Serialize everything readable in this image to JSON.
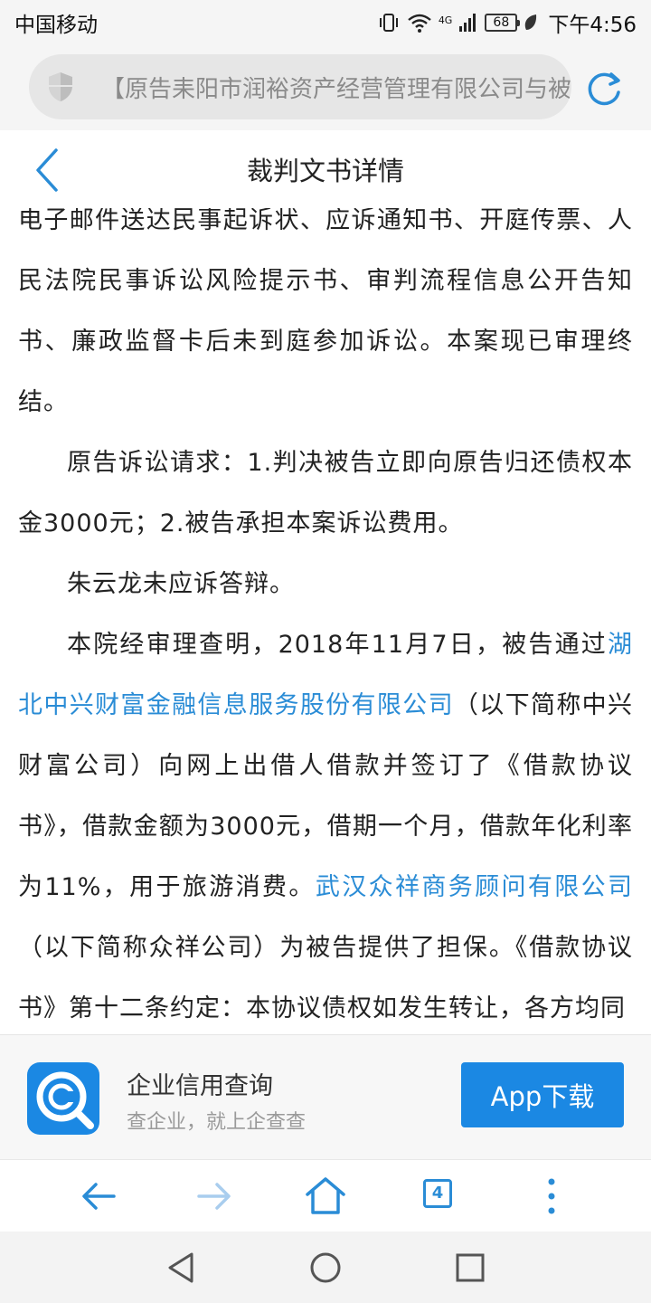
{
  "status_bar": {
    "carrier": "中国移动",
    "network": "4G",
    "battery": "68",
    "time": "下午4:56"
  },
  "url_bar": {
    "url_text": "【原告耒阳市润裕资产经营管理有限公司与被"
  },
  "header": {
    "title": "裁判文书详情"
  },
  "article": {
    "p1": "电子邮件送达民事起诉状、应诉通知书、开庭传票、人民法院民事诉讼风险提示书、审判流程信息公开告知书、廉政监督卡后未到庭参加诉讼。本案现已审理终结。",
    "p2": "原告诉讼请求：1.判决被告立即向原告归还债权本金3000元；2.被告承担本案诉讼费用。",
    "p3": "朱云龙未应诉答辩。",
    "p4_a": "本院经审理查明，2018年11月7日，被告通过",
    "p4_link1": "湖北中兴财富金融信息服务股份有限公司",
    "p4_b": "（以下简称中兴财富公司）向网上出借人借款并签订了《借款协议书》，借款金额为3000元，借期一个月，借款年化利率为11%，用于旅游消费。",
    "p4_link2": "武汉众祥商务顾问有限公司",
    "p4_c": "（以下简称众祥公司）为被告提供了担保。《借款协议书》第十二条约定：本协议债权如发生转让，各方均同"
  },
  "banner": {
    "title": "企业信用查询",
    "subtitle": "查企业，就上企查查",
    "button": "App下载"
  },
  "browser_toolbar": {
    "tabs_count": "4"
  },
  "colors": {
    "accent": "#1b88e3",
    "link": "#2a8cd6"
  }
}
